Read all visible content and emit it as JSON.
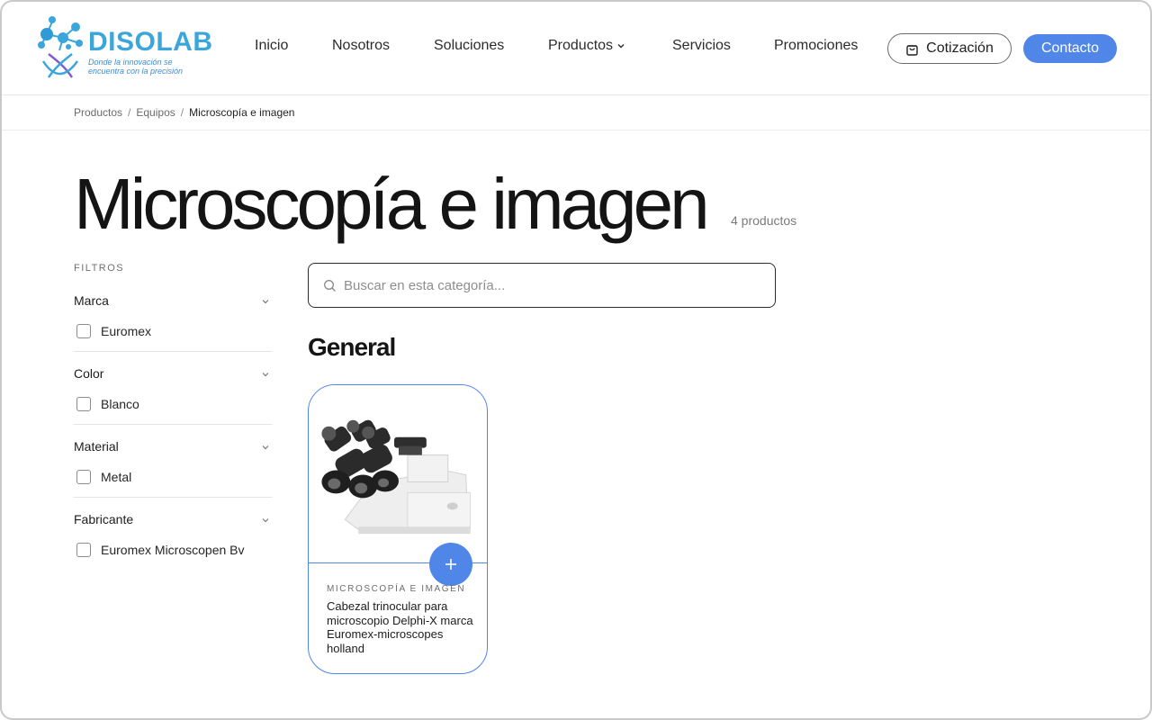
{
  "brand": {
    "name": "DISOLAB",
    "tagline": "Donde la innovación se encuentra con la precisión",
    "color": "#3aa6db"
  },
  "nav": {
    "items": [
      {
        "label": "Inicio"
      },
      {
        "label": "Nosotros"
      },
      {
        "label": "Soluciones"
      },
      {
        "label": "Productos"
      },
      {
        "label": "Servicios"
      },
      {
        "label": "Promociones"
      }
    ],
    "cotizacion_label": "Cotización",
    "contacto_label": "Contacto",
    "accent": "#4f86e8"
  },
  "breadcrumb": {
    "items": [
      "Productos",
      "Equipos"
    ],
    "current": "Microscopía e imagen"
  },
  "page": {
    "title": "Microscopía e imagen",
    "count": "4 productos"
  },
  "filters": {
    "label": "FILTROS",
    "groups": [
      {
        "title": "Marca",
        "option": "Euromex"
      },
      {
        "title": "Color",
        "option": "Blanco"
      },
      {
        "title": "Material",
        "option": "Metal"
      },
      {
        "title": "Fabricante",
        "option": "Euromex Microscopen Bv"
      }
    ]
  },
  "search": {
    "placeholder": "Buscar en esta categoría...",
    "value": ""
  },
  "section": {
    "title": "General"
  },
  "products": [
    {
      "category": "MICROSCOPÍA E IMAGEN",
      "name": "Cabezal trinocular para microscopio Delphi-X marca Euromex-microscopes holland",
      "image": "microscope-trinocular-head"
    }
  ],
  "icons": {
    "cart": "shopping-bag-icon",
    "search": "search-icon",
    "chevron": "chevron-down-icon",
    "add": "plus-icon"
  }
}
